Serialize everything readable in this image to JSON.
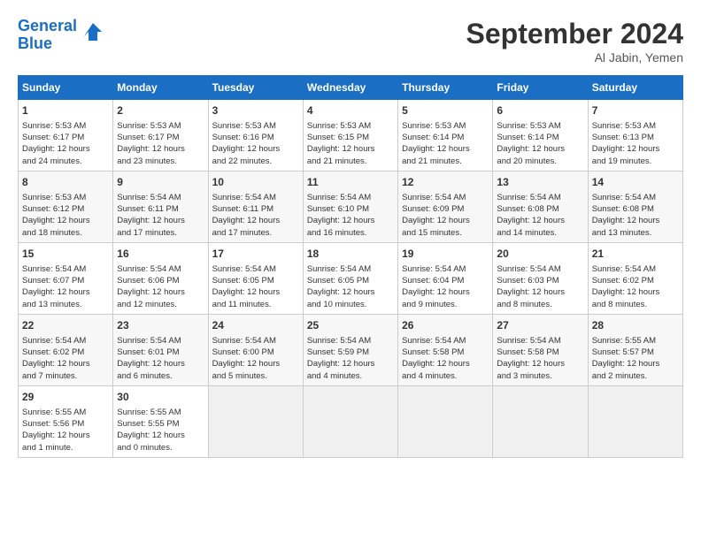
{
  "header": {
    "logo_line1": "General",
    "logo_line2": "Blue",
    "month_year": "September 2024",
    "location": "Al Jabin, Yemen"
  },
  "days_of_week": [
    "Sunday",
    "Monday",
    "Tuesday",
    "Wednesday",
    "Thursday",
    "Friday",
    "Saturday"
  ],
  "weeks": [
    [
      {
        "day": "1",
        "lines": [
          "Sunrise: 5:53 AM",
          "Sunset: 6:17 PM",
          "Daylight: 12 hours",
          "and 24 minutes."
        ]
      },
      {
        "day": "2",
        "lines": [
          "Sunrise: 5:53 AM",
          "Sunset: 6:17 PM",
          "Daylight: 12 hours",
          "and 23 minutes."
        ]
      },
      {
        "day": "3",
        "lines": [
          "Sunrise: 5:53 AM",
          "Sunset: 6:16 PM",
          "Daylight: 12 hours",
          "and 22 minutes."
        ]
      },
      {
        "day": "4",
        "lines": [
          "Sunrise: 5:53 AM",
          "Sunset: 6:15 PM",
          "Daylight: 12 hours",
          "and 21 minutes."
        ]
      },
      {
        "day": "5",
        "lines": [
          "Sunrise: 5:53 AM",
          "Sunset: 6:14 PM",
          "Daylight: 12 hours",
          "and 21 minutes."
        ]
      },
      {
        "day": "6",
        "lines": [
          "Sunrise: 5:53 AM",
          "Sunset: 6:14 PM",
          "Daylight: 12 hours",
          "and 20 minutes."
        ]
      },
      {
        "day": "7",
        "lines": [
          "Sunrise: 5:53 AM",
          "Sunset: 6:13 PM",
          "Daylight: 12 hours",
          "and 19 minutes."
        ]
      }
    ],
    [
      {
        "day": "8",
        "lines": [
          "Sunrise: 5:53 AM",
          "Sunset: 6:12 PM",
          "Daylight: 12 hours",
          "and 18 minutes."
        ]
      },
      {
        "day": "9",
        "lines": [
          "Sunrise: 5:54 AM",
          "Sunset: 6:11 PM",
          "Daylight: 12 hours",
          "and 17 minutes."
        ]
      },
      {
        "day": "10",
        "lines": [
          "Sunrise: 5:54 AM",
          "Sunset: 6:11 PM",
          "Daylight: 12 hours",
          "and 17 minutes."
        ]
      },
      {
        "day": "11",
        "lines": [
          "Sunrise: 5:54 AM",
          "Sunset: 6:10 PM",
          "Daylight: 12 hours",
          "and 16 minutes."
        ]
      },
      {
        "day": "12",
        "lines": [
          "Sunrise: 5:54 AM",
          "Sunset: 6:09 PM",
          "Daylight: 12 hours",
          "and 15 minutes."
        ]
      },
      {
        "day": "13",
        "lines": [
          "Sunrise: 5:54 AM",
          "Sunset: 6:08 PM",
          "Daylight: 12 hours",
          "and 14 minutes."
        ]
      },
      {
        "day": "14",
        "lines": [
          "Sunrise: 5:54 AM",
          "Sunset: 6:08 PM",
          "Daylight: 12 hours",
          "and 13 minutes."
        ]
      }
    ],
    [
      {
        "day": "15",
        "lines": [
          "Sunrise: 5:54 AM",
          "Sunset: 6:07 PM",
          "Daylight: 12 hours",
          "and 13 minutes."
        ]
      },
      {
        "day": "16",
        "lines": [
          "Sunrise: 5:54 AM",
          "Sunset: 6:06 PM",
          "Daylight: 12 hours",
          "and 12 minutes."
        ]
      },
      {
        "day": "17",
        "lines": [
          "Sunrise: 5:54 AM",
          "Sunset: 6:05 PM",
          "Daylight: 12 hours",
          "and 11 minutes."
        ]
      },
      {
        "day": "18",
        "lines": [
          "Sunrise: 5:54 AM",
          "Sunset: 6:05 PM",
          "Daylight: 12 hours",
          "and 10 minutes."
        ]
      },
      {
        "day": "19",
        "lines": [
          "Sunrise: 5:54 AM",
          "Sunset: 6:04 PM",
          "Daylight: 12 hours",
          "and 9 minutes."
        ]
      },
      {
        "day": "20",
        "lines": [
          "Sunrise: 5:54 AM",
          "Sunset: 6:03 PM",
          "Daylight: 12 hours",
          "and 8 minutes."
        ]
      },
      {
        "day": "21",
        "lines": [
          "Sunrise: 5:54 AM",
          "Sunset: 6:02 PM",
          "Daylight: 12 hours",
          "and 8 minutes."
        ]
      }
    ],
    [
      {
        "day": "22",
        "lines": [
          "Sunrise: 5:54 AM",
          "Sunset: 6:02 PM",
          "Daylight: 12 hours",
          "and 7 minutes."
        ]
      },
      {
        "day": "23",
        "lines": [
          "Sunrise: 5:54 AM",
          "Sunset: 6:01 PM",
          "Daylight: 12 hours",
          "and 6 minutes."
        ]
      },
      {
        "day": "24",
        "lines": [
          "Sunrise: 5:54 AM",
          "Sunset: 6:00 PM",
          "Daylight: 12 hours",
          "and 5 minutes."
        ]
      },
      {
        "day": "25",
        "lines": [
          "Sunrise: 5:54 AM",
          "Sunset: 5:59 PM",
          "Daylight: 12 hours",
          "and 4 minutes."
        ]
      },
      {
        "day": "26",
        "lines": [
          "Sunrise: 5:54 AM",
          "Sunset: 5:58 PM",
          "Daylight: 12 hours",
          "and 4 minutes."
        ]
      },
      {
        "day": "27",
        "lines": [
          "Sunrise: 5:54 AM",
          "Sunset: 5:58 PM",
          "Daylight: 12 hours",
          "and 3 minutes."
        ]
      },
      {
        "day": "28",
        "lines": [
          "Sunrise: 5:55 AM",
          "Sunset: 5:57 PM",
          "Daylight: 12 hours",
          "and 2 minutes."
        ]
      }
    ],
    [
      {
        "day": "29",
        "lines": [
          "Sunrise: 5:55 AM",
          "Sunset: 5:56 PM",
          "Daylight: 12 hours",
          "and 1 minute."
        ]
      },
      {
        "day": "30",
        "lines": [
          "Sunrise: 5:55 AM",
          "Sunset: 5:55 PM",
          "Daylight: 12 hours",
          "and 0 minutes."
        ]
      },
      {
        "day": "",
        "lines": []
      },
      {
        "day": "",
        "lines": []
      },
      {
        "day": "",
        "lines": []
      },
      {
        "day": "",
        "lines": []
      },
      {
        "day": "",
        "lines": []
      }
    ]
  ]
}
